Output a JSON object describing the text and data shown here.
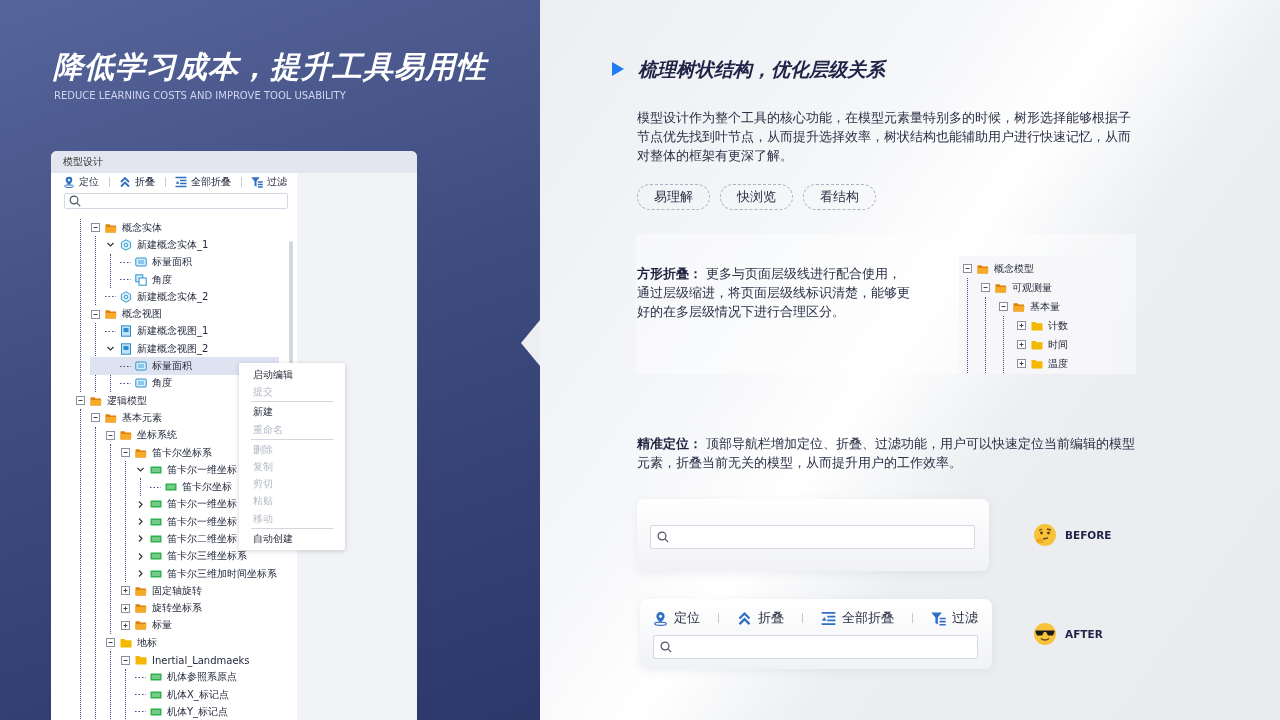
{
  "hero": {
    "title": "降低学习成本，提升工具易用性",
    "subtitle": "REDUCE LEARNING COSTS AND IMPROVE TOOL USABILITY"
  },
  "panel": {
    "title": "模型设计",
    "toolbar": [
      {
        "kind": "locate",
        "label": "定位"
      },
      {
        "kind": "collapse",
        "label": "折叠"
      },
      {
        "kind": "collapse-all",
        "label": "全部折叠"
      },
      {
        "kind": "filter",
        "label": "过滤"
      }
    ],
    "tree": [
      {
        "kind": "continuation",
        "children": [
          {
            "label": "概念实体",
            "kind": "folder-open",
            "expanded": true,
            "selected": false,
            "children": [
              {
                "label": "新建概念实体_1",
                "kind": "entity",
                "expanded": true,
                "selected": false,
                "children": [
                  {
                    "label": "标量面积",
                    "kind": "field",
                    "selected": false
                  },
                  {
                    "label": "角度",
                    "kind": "angle",
                    "selected": false
                  }
                ]
              },
              {
                "label": "新建概念实体_2",
                "kind": "entity",
                "selected": false
              }
            ]
          },
          {
            "label": "概念视图",
            "kind": "folder-open",
            "expanded": true,
            "selected": false,
            "children": [
              {
                "label": "新建概念视图_1",
                "kind": "view",
                "selected": false
              },
              {
                "label": "新建概念视图_2",
                "kind": "view",
                "expanded": true,
                "selected": false,
                "children": [
                  {
                    "label": "标量面积",
                    "kind": "field",
                    "selected": true
                  },
                  {
                    "label": "角度",
                    "kind": "field",
                    "selected": false
                  }
                ]
              }
            ]
          }
        ]
      },
      {
        "label": "逻辑模型",
        "kind": "folder-open",
        "expanded": true,
        "selected": false,
        "children": [
          {
            "label": "基本元素",
            "kind": "folder-open",
            "expanded": true,
            "selected": false,
            "children": [
              {
                "label": "坐标系统",
                "kind": "folder-open",
                "expanded": true,
                "selected": false,
                "children": [
                  {
                    "label": "笛卡尔坐标系",
                    "kind": "folder-open",
                    "expanded": true,
                    "selected": false,
                    "children": [
                      {
                        "label": "笛卡尔一维坐标",
                        "kind": "coord",
                        "expanded": true,
                        "selected": false,
                        "children": [
                          {
                            "label": "笛卡尔坐标",
                            "kind": "coord",
                            "selected": false
                          }
                        ]
                      },
                      {
                        "label": "笛卡尔一维坐标",
                        "kind": "coord",
                        "expanded": false,
                        "selected": false
                      },
                      {
                        "label": "笛卡尔一维坐标",
                        "kind": "coord",
                        "expanded": false,
                        "selected": false
                      },
                      {
                        "label": "笛卡尔二维坐标",
                        "kind": "coord",
                        "expanded": false,
                        "selected": false
                      },
                      {
                        "label": "笛卡尔三维坐标系",
                        "kind": "coord",
                        "expanded": false,
                        "selected": false
                      },
                      {
                        "label": "笛卡尔三维加时间坐标系",
                        "kind": "coord",
                        "expanded": false,
                        "selected": false
                      }
                    ]
                  },
                  {
                    "label": "固定轴旋转",
                    "kind": "folder-open",
                    "expanded": false,
                    "selected": false
                  },
                  {
                    "label": "旋转坐标系",
                    "kind": "folder-open",
                    "expanded": false,
                    "selected": false
                  },
                  {
                    "label": "标量",
                    "kind": "folder-open",
                    "expanded": false,
                    "selected": false
                  }
                ]
              },
              {
                "label": "地标",
                "kind": "folder",
                "expanded": true,
                "selected": false,
                "children": [
                  {
                    "label": "Inertial_Landmaeks",
                    "kind": "folder",
                    "expanded": true,
                    "selected": false,
                    "children": [
                      {
                        "label": "机体参照系原点",
                        "kind": "coord",
                        "selected": false
                      },
                      {
                        "label": "机体X_标记点",
                        "kind": "coord",
                        "selected": false
                      },
                      {
                        "label": "机体Y_标记点",
                        "kind": "coord",
                        "selected": false
                      }
                    ]
                  }
                ]
              }
            ]
          }
        ]
      }
    ],
    "context_menu": [
      [
        {
          "label": "启动编辑",
          "disabled": false
        },
        {
          "label": "提交",
          "disabled": true
        }
      ],
      [
        {
          "label": "新建",
          "disabled": false
        },
        {
          "label": "重命名",
          "disabled": true
        }
      ],
      [
        {
          "label": "删除",
          "disabled": true
        },
        {
          "label": "复制",
          "disabled": true
        },
        {
          "label": "剪切",
          "disabled": true
        },
        {
          "label": "粘贴",
          "disabled": true
        },
        {
          "label": "移动",
          "disabled": true
        }
      ],
      [
        {
          "label": "自动创建",
          "disabled": false
        }
      ]
    ]
  },
  "section": {
    "heading": "梳理树状结构，优化层级关系",
    "intro": "模型设计作为整个工具的核心功能，在模型元素量特别多的时候，树形选择能够根据子节点优先找到叶节点，从而提升选择效率，树状结构也能辅助用户进行快速记忆，从而对整体的框架有更深了解。",
    "tags": [
      "易理解",
      "快浏览",
      "看结构"
    ]
  },
  "feature_fold": {
    "text": "**方形折叠：** 更多与页面层级线进行配合使用，通过层级缩进，将页面层级线标识清楚，能够更好的在多层级情况下进行合理区分。",
    "tree": [
      {
        "label": "概念模型",
        "kind": "folder-open",
        "expanded": true,
        "children": [
          {
            "label": "可观测量",
            "kind": "folder-open",
            "expanded": true,
            "children": [
              {
                "label": "基本量",
                "kind": "folder-open",
                "expanded": true,
                "children": [
                  {
                    "label": "计数",
                    "kind": "folder",
                    "expanded": false
                  },
                  {
                    "label": "时间",
                    "kind": "folder",
                    "expanded": false
                  },
                  {
                    "label": "温度",
                    "kind": "folder",
                    "expanded": false
                  }
                ]
              }
            ]
          }
        ]
      }
    ]
  },
  "feature_locate": {
    "text": "**精准定位：** 顶部导航栏增加定位、折叠、过滤功能，用户可以快速定位当前编辑的模型元素，折叠当前无关的模型，从而提升用户的工作效率。"
  },
  "comparison": [
    {
      "label": "BEFORE",
      "kind": "before"
    },
    {
      "label": "AFTER",
      "kind": "after",
      "toolbar": [
        {
          "kind": "locate",
          "label": "定位"
        },
        {
          "kind": "collapse",
          "label": "折叠"
        },
        {
          "kind": "collapse-all",
          "label": "全部折叠"
        },
        {
          "kind": "filter",
          "label": "过滤"
        }
      ]
    }
  ]
}
